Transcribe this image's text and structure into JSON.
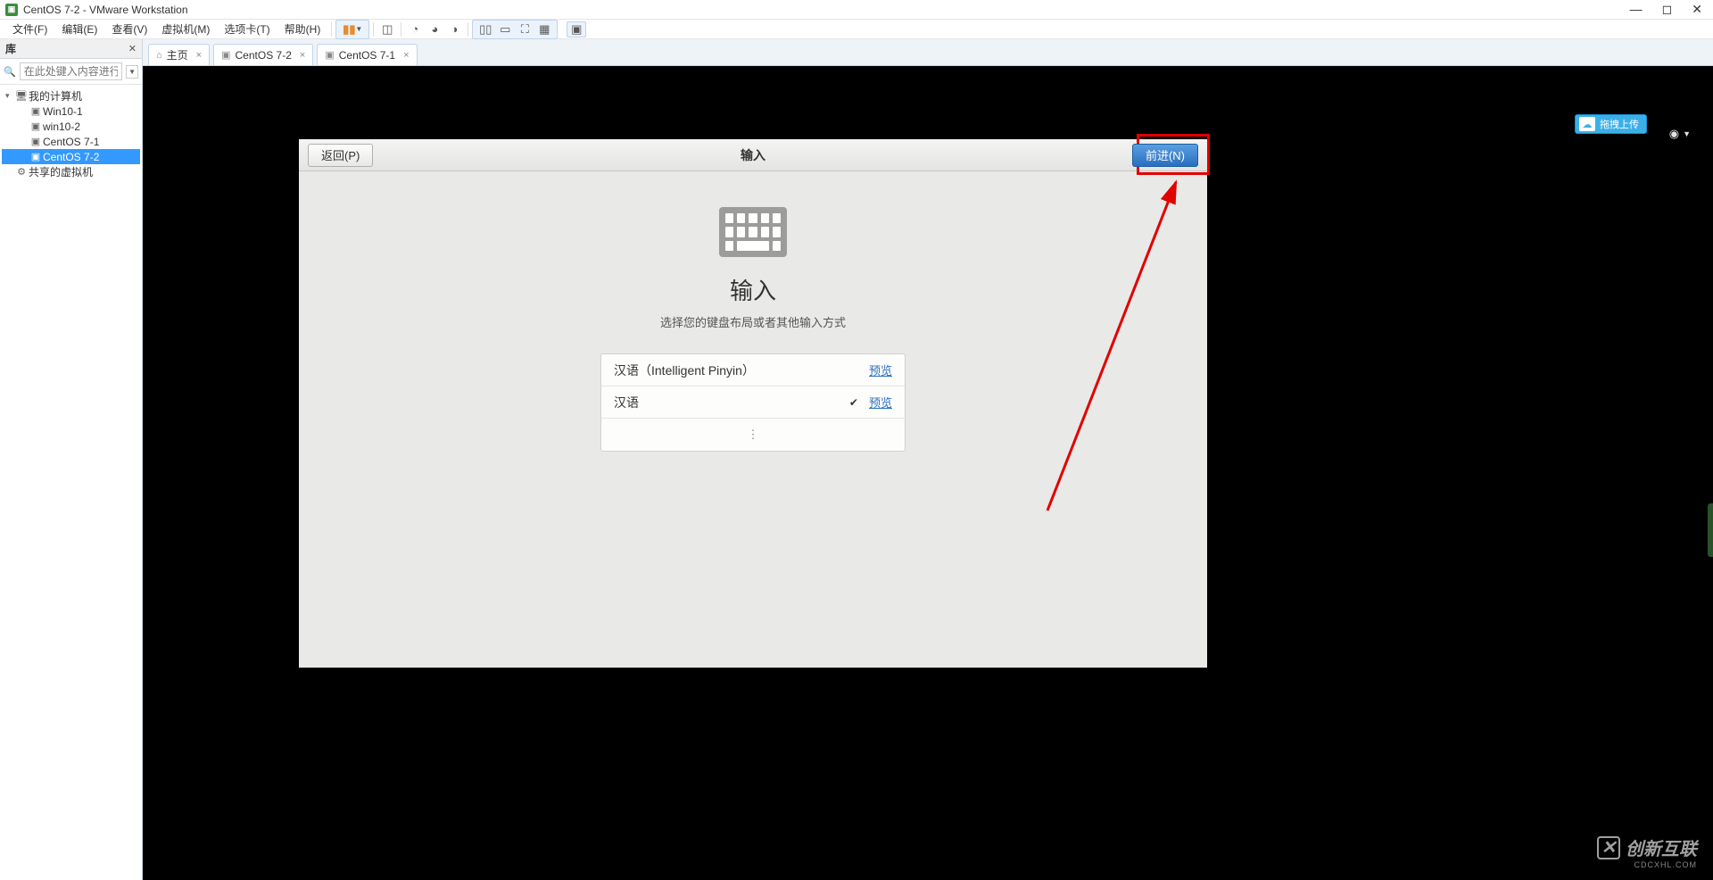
{
  "window": {
    "title": "CentOS 7-2 - VMware Workstation",
    "min": "—",
    "max": "◻",
    "close": "✕"
  },
  "menu": {
    "file": "文件(F)",
    "edit": "编辑(E)",
    "view": "查看(V)",
    "vm": "虚拟机(M)",
    "tabs": "选项卡(T)",
    "help": "帮助(H)"
  },
  "library": {
    "title": "库",
    "searchPlaceholder": "在此处键入内容进行搜索",
    "root": "我的计算机",
    "items": [
      "Win10-1",
      "win10-2",
      "CentOS 7-1",
      "CentOS 7-2"
    ],
    "shared": "共享的虚拟机"
  },
  "tabs": [
    {
      "label": "主页"
    },
    {
      "label": "CentOS 7-2"
    },
    {
      "label": "CentOS 7-1"
    }
  ],
  "installer": {
    "back": "返回(P)",
    "forward": "前进(N)",
    "barTitle": "输入",
    "title": "输入",
    "subtitle": "选择您的键盘布局或者其他输入方式",
    "opt1": "汉语（Intelligent Pinyin）",
    "opt2": "汉语",
    "preview": "预览",
    "more": "⋮"
  },
  "overlay": {
    "upload": "拖拽上传"
  },
  "watermark": {
    "brand": "创新互联",
    "sub": "CDCXHL.COM"
  }
}
